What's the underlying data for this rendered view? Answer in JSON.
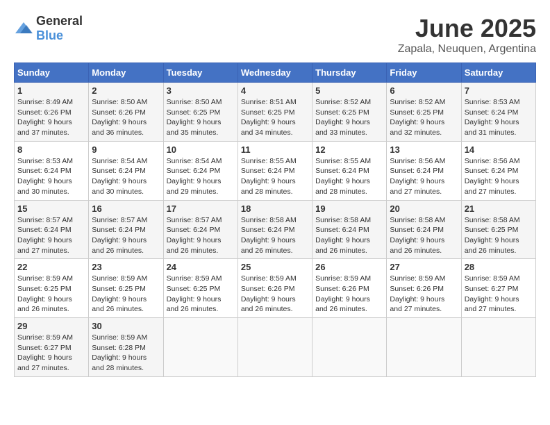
{
  "header": {
    "logo_general": "General",
    "logo_blue": "Blue",
    "month_title": "June 2025",
    "location": "Zapala, Neuquen, Argentina"
  },
  "calendar": {
    "days_of_week": [
      "Sunday",
      "Monday",
      "Tuesday",
      "Wednesday",
      "Thursday",
      "Friday",
      "Saturday"
    ],
    "weeks": [
      [
        {
          "day": "1",
          "sunrise": "8:49 AM",
          "sunset": "6:26 PM",
          "daylight": "9 hours and 37 minutes."
        },
        {
          "day": "2",
          "sunrise": "8:50 AM",
          "sunset": "6:26 PM",
          "daylight": "9 hours and 36 minutes."
        },
        {
          "day": "3",
          "sunrise": "8:50 AM",
          "sunset": "6:25 PM",
          "daylight": "9 hours and 35 minutes."
        },
        {
          "day": "4",
          "sunrise": "8:51 AM",
          "sunset": "6:25 PM",
          "daylight": "9 hours and 34 minutes."
        },
        {
          "day": "5",
          "sunrise": "8:52 AM",
          "sunset": "6:25 PM",
          "daylight": "9 hours and 33 minutes."
        },
        {
          "day": "6",
          "sunrise": "8:52 AM",
          "sunset": "6:25 PM",
          "daylight": "9 hours and 32 minutes."
        },
        {
          "day": "7",
          "sunrise": "8:53 AM",
          "sunset": "6:24 PM",
          "daylight": "9 hours and 31 minutes."
        }
      ],
      [
        {
          "day": "8",
          "sunrise": "8:53 AM",
          "sunset": "6:24 PM",
          "daylight": "9 hours and 30 minutes."
        },
        {
          "day": "9",
          "sunrise": "8:54 AM",
          "sunset": "6:24 PM",
          "daylight": "9 hours and 30 minutes."
        },
        {
          "day": "10",
          "sunrise": "8:54 AM",
          "sunset": "6:24 PM",
          "daylight": "9 hours and 29 minutes."
        },
        {
          "day": "11",
          "sunrise": "8:55 AM",
          "sunset": "6:24 PM",
          "daylight": "9 hours and 28 minutes."
        },
        {
          "day": "12",
          "sunrise": "8:55 AM",
          "sunset": "6:24 PM",
          "daylight": "9 hours and 28 minutes."
        },
        {
          "day": "13",
          "sunrise": "8:56 AM",
          "sunset": "6:24 PM",
          "daylight": "9 hours and 27 minutes."
        },
        {
          "day": "14",
          "sunrise": "8:56 AM",
          "sunset": "6:24 PM",
          "daylight": "9 hours and 27 minutes."
        }
      ],
      [
        {
          "day": "15",
          "sunrise": "8:57 AM",
          "sunset": "6:24 PM",
          "daylight": "9 hours and 27 minutes."
        },
        {
          "day": "16",
          "sunrise": "8:57 AM",
          "sunset": "6:24 PM",
          "daylight": "9 hours and 26 minutes."
        },
        {
          "day": "17",
          "sunrise": "8:57 AM",
          "sunset": "6:24 PM",
          "daylight": "9 hours and 26 minutes."
        },
        {
          "day": "18",
          "sunrise": "8:58 AM",
          "sunset": "6:24 PM",
          "daylight": "9 hours and 26 minutes."
        },
        {
          "day": "19",
          "sunrise": "8:58 AM",
          "sunset": "6:24 PM",
          "daylight": "9 hours and 26 minutes."
        },
        {
          "day": "20",
          "sunrise": "8:58 AM",
          "sunset": "6:24 PM",
          "daylight": "9 hours and 26 minutes."
        },
        {
          "day": "21",
          "sunrise": "8:58 AM",
          "sunset": "6:25 PM",
          "daylight": "9 hours and 26 minutes."
        }
      ],
      [
        {
          "day": "22",
          "sunrise": "8:59 AM",
          "sunset": "6:25 PM",
          "daylight": "9 hours and 26 minutes."
        },
        {
          "day": "23",
          "sunrise": "8:59 AM",
          "sunset": "6:25 PM",
          "daylight": "9 hours and 26 minutes."
        },
        {
          "day": "24",
          "sunrise": "8:59 AM",
          "sunset": "6:25 PM",
          "daylight": "9 hours and 26 minutes."
        },
        {
          "day": "25",
          "sunrise": "8:59 AM",
          "sunset": "6:26 PM",
          "daylight": "9 hours and 26 minutes."
        },
        {
          "day": "26",
          "sunrise": "8:59 AM",
          "sunset": "6:26 PM",
          "daylight": "9 hours and 26 minutes."
        },
        {
          "day": "27",
          "sunrise": "8:59 AM",
          "sunset": "6:26 PM",
          "daylight": "9 hours and 27 minutes."
        },
        {
          "day": "28",
          "sunrise": "8:59 AM",
          "sunset": "6:27 PM",
          "daylight": "9 hours and 27 minutes."
        }
      ],
      [
        {
          "day": "29",
          "sunrise": "8:59 AM",
          "sunset": "6:27 PM",
          "daylight": "9 hours and 27 minutes."
        },
        {
          "day": "30",
          "sunrise": "8:59 AM",
          "sunset": "6:28 PM",
          "daylight": "9 hours and 28 minutes."
        },
        null,
        null,
        null,
        null,
        null
      ]
    ]
  }
}
